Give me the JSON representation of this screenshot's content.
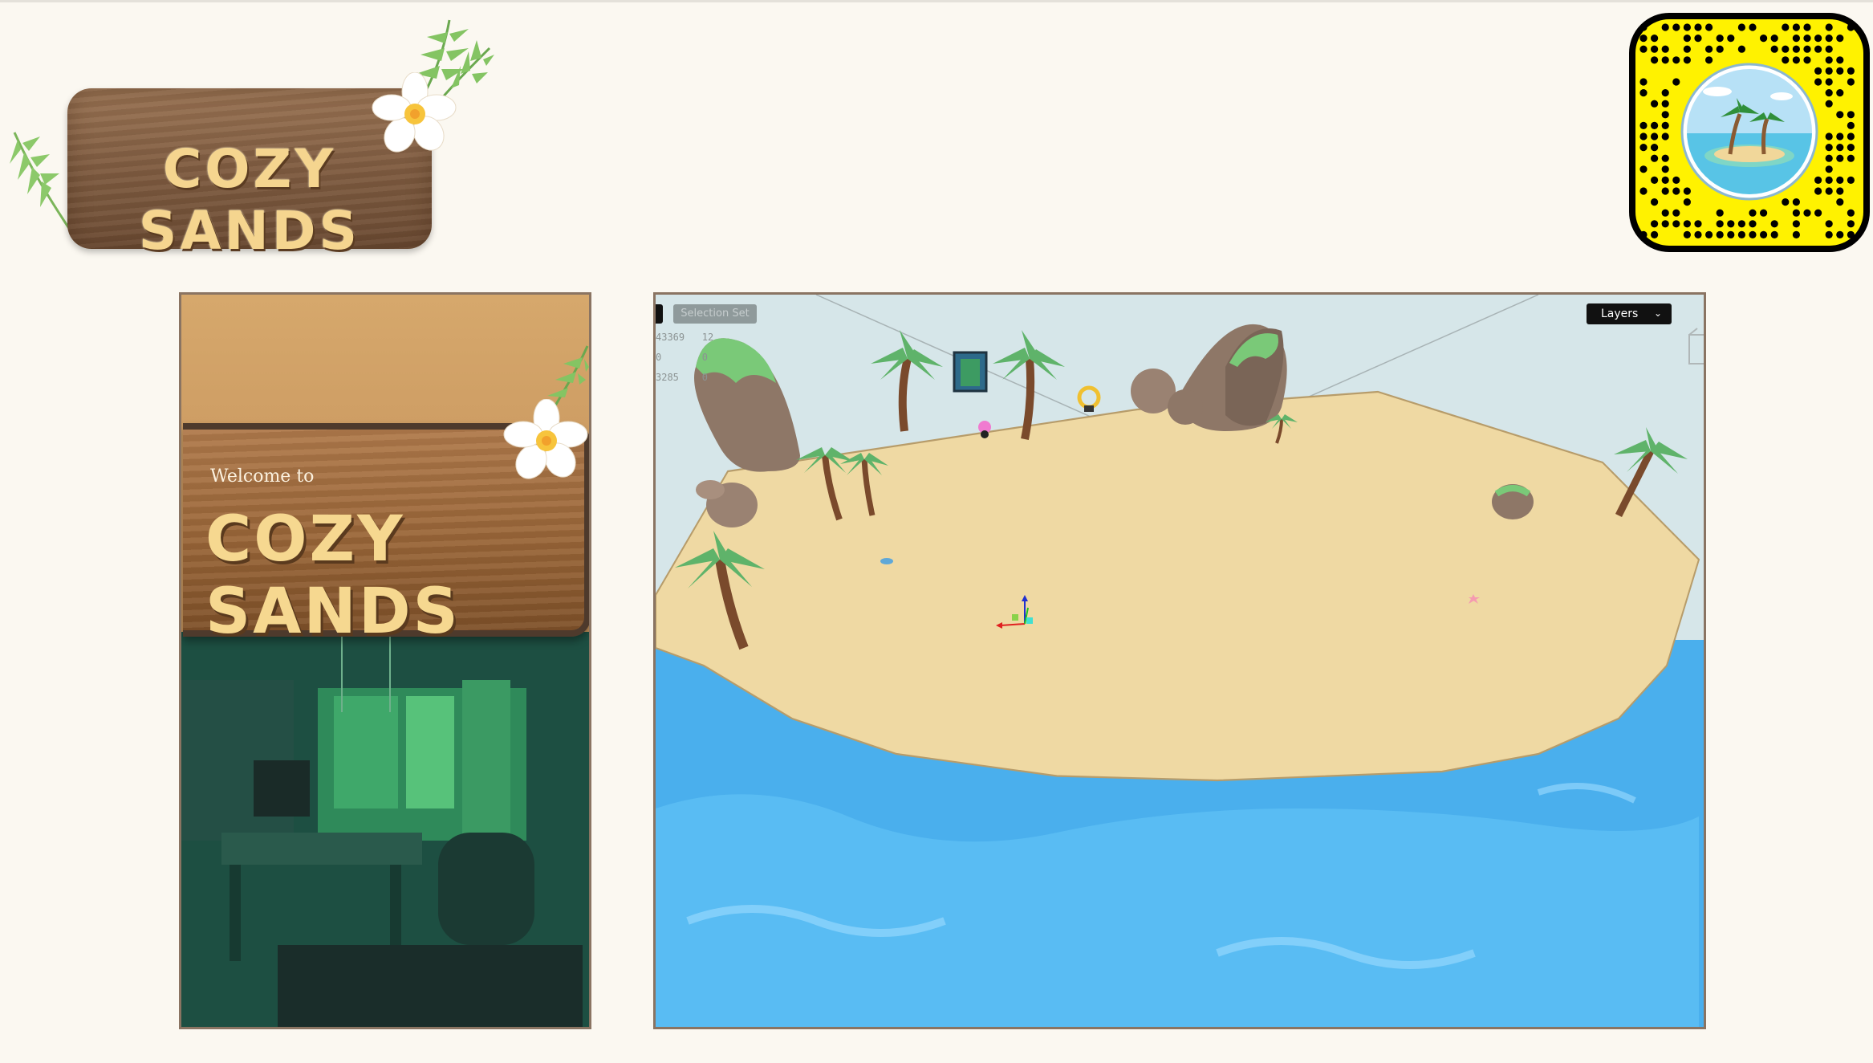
{
  "logo": {
    "title": "COZY SANDS"
  },
  "snapcode": {
    "icon": "snapcode-icon",
    "color": "#fff200"
  },
  "left_panel": {
    "welcome": "Welcome to",
    "title": "COZY SANDS"
  },
  "viewport": {
    "selection_set_label": "Selection Set",
    "stats": [
      "43369   12",
      "0       0",
      "3285    0"
    ],
    "layers_label": "Layers",
    "layers_icon": "chevron-down-icon",
    "gizmo_icon": "transform-gizmo-icon"
  },
  "colors": {
    "background": "#fbf8f1",
    "sand": "#efd8a2",
    "water": "#4fb4ee",
    "panel_border": "#8a7462"
  }
}
